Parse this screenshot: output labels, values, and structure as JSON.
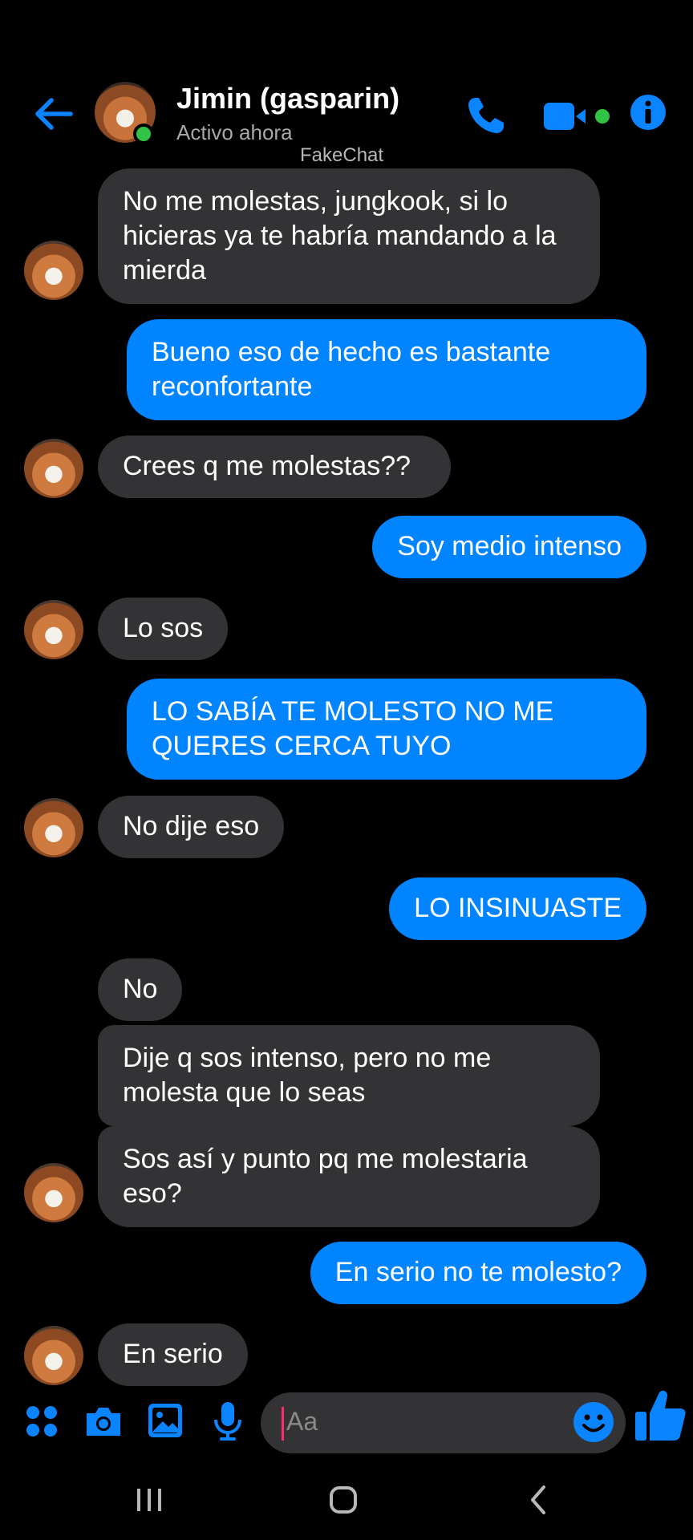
{
  "header": {
    "contact_name": "Jimin (gasparin)",
    "status": "Activo ahora",
    "watermark": "FakeChat"
  },
  "messages": [
    {
      "side": "in",
      "text": "No me molestas, jungkook, si lo hicieras ya te habría mandando a la mierda"
    },
    {
      "side": "out",
      "text": "Bueno eso de hecho es bastante reconfortante"
    },
    {
      "side": "in",
      "text": "Crees q me molestas??"
    },
    {
      "side": "out",
      "text": "Soy medio intenso"
    },
    {
      "side": "in",
      "text": "Lo sos"
    },
    {
      "side": "out",
      "text": "LO SABÍA TE MOLESTO NO ME QUERES CERCA TUYO"
    },
    {
      "side": "in",
      "text": "No dije eso"
    },
    {
      "side": "out",
      "text": "LO INSINUASTE"
    },
    {
      "side": "in",
      "text": "No"
    },
    {
      "side": "in",
      "text": "Dije q sos intenso, pero no me molesta que lo seas"
    },
    {
      "side": "in",
      "text": "Sos así y punto pq me molestaria eso?"
    },
    {
      "side": "out",
      "text": "En serio no te molesto?"
    },
    {
      "side": "in",
      "text": "En serio"
    }
  ],
  "composer": {
    "placeholder": "Aa",
    "icons": [
      "apps-icon",
      "camera-icon",
      "gallery-icon",
      "mic-icon",
      "emoji-icon",
      "like-icon"
    ]
  },
  "colors": {
    "accent": "#0084ff",
    "incoming_bubble": "#333335",
    "online": "#31c345",
    "background": "#000000"
  }
}
